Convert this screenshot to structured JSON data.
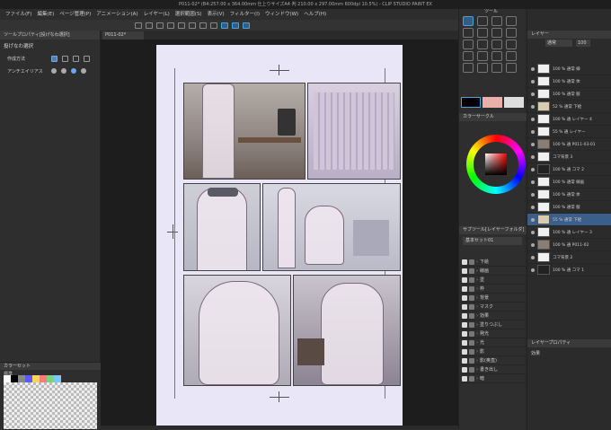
{
  "window": {
    "title": "P011-02* (B4:257.00 x 364.00mm 仕上りサイズA4 判 210.00 x 297.00mm 600dpi 10.5%) - CLIP STUDIO PAINT EX"
  },
  "menu": [
    "ファイル(F)",
    "編集(E)",
    "ページ管理(P)",
    "アニメーション(A)",
    "レイヤー(L)",
    "選択範囲(S)",
    "表示(V)",
    "フィルター(I)",
    "ウィンドウ(W)",
    "ヘルプ(H)"
  ],
  "tool_property": {
    "header": "ツールプロパティ[投げなわ選択]",
    "title": "投げなわ選択",
    "rows": [
      {
        "label": "作成方法"
      },
      {
        "label": "アンチエイリアス"
      }
    ]
  },
  "color_set": {
    "header": "カラーセット",
    "name": "標準"
  },
  "canvas": {
    "tab": "P011-02*"
  },
  "tool_panel": {
    "header": "ツール"
  },
  "color_wheel": {
    "header": "カラーサークル"
  },
  "layer_panel": {
    "header": "レイヤー",
    "blend": "通常",
    "opacity": "100"
  },
  "sub_tool": {
    "header": "サブツール[レイヤーフォルダ]",
    "preset": "基本セット01",
    "items": [
      "下絵",
      "線画",
      "塗",
      "枠",
      "背景",
      "マスク",
      "効果",
      "塗りつぶし",
      "発光",
      "光",
      "影",
      "影(奥直)",
      "書き出し",
      "暗"
    ]
  },
  "layers": [
    {
      "label": "100 % 通常 線"
    },
    {
      "label": "100 % 通常 体"
    },
    {
      "label": "100 % 通常 服"
    },
    {
      "label": "52 % 通常 下絵"
    },
    {
      "label": "100 % 通 レイヤー 4"
    },
    {
      "label": "55 % 通 レイヤー"
    },
    {
      "label": "100 % 通 P011-03-01"
    },
    {
      "label": "コマ背景 3"
    },
    {
      "label": "100 % 通 コマ 2"
    },
    {
      "label": "100 % 通常 線画"
    },
    {
      "label": "100 % 通常 体"
    },
    {
      "label": "100 % 通常 服"
    },
    {
      "label": "55 % 通常 下絵"
    },
    {
      "label": "100 % 通 レイヤー 3"
    },
    {
      "label": "100 % 通 P011-02"
    },
    {
      "label": "コマ背景 2"
    },
    {
      "label": "100 % 通 コマ 1"
    }
  ],
  "layer_property": {
    "header": "レイヤープロパティ",
    "effect": "効果"
  },
  "colors": {
    "accent": "#4aa3e0",
    "main_color": "#e8b0a8",
    "sub_color": "#ffffff"
  }
}
